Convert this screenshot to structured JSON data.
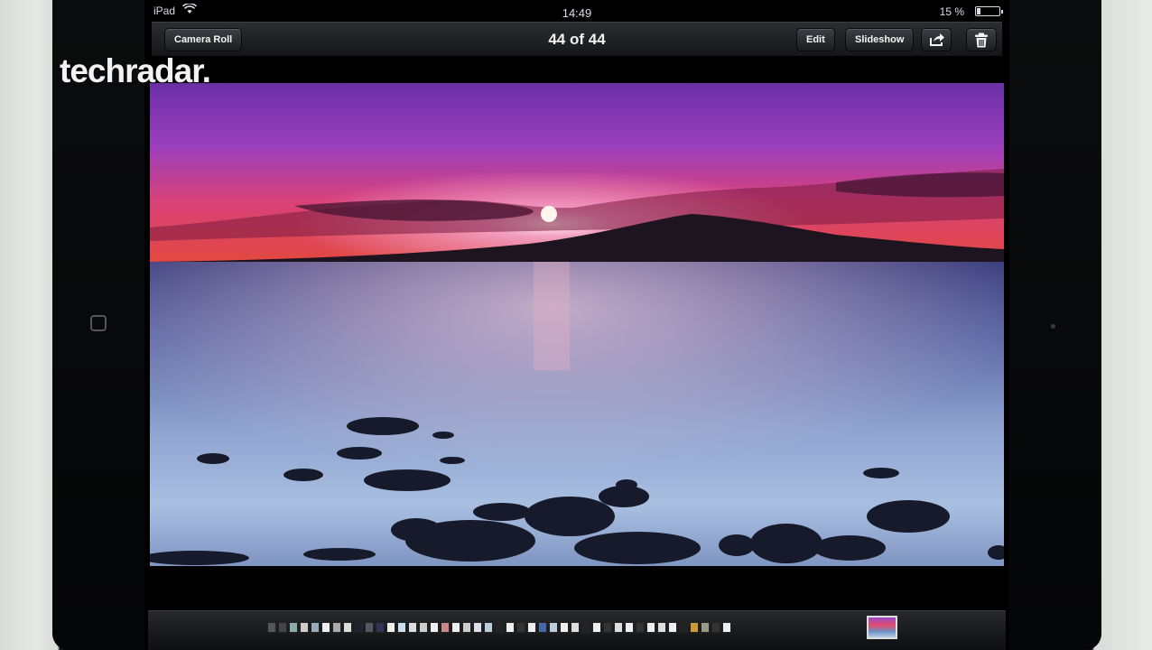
{
  "status_bar": {
    "carrier": "iPad",
    "time": "14:49",
    "battery_text": "15 %",
    "battery_level": 0.15
  },
  "navbar": {
    "back_label": "Camera Roll",
    "title": "44 of 44",
    "edit_label": "Edit",
    "slideshow_label": "Slideshow",
    "share_icon": "share-icon",
    "trash_icon": "trash-icon"
  },
  "photo": {
    "subject": "photo-sunset-seascape"
  },
  "scrubber": {
    "thumbnail_count": 44,
    "selected_index": 44,
    "thumb_colors": [
      "#555",
      "#444",
      "#8aa",
      "#ccc",
      "#9ab",
      "#eee",
      "#aaa",
      "#ddd",
      "#223",
      "#556",
      "#335",
      "#eee",
      "#cde",
      "#ddd",
      "#ccc",
      "#eee",
      "#c88",
      "#eee",
      "#ccc",
      "#dde",
      "#bcd",
      "#222",
      "#eee",
      "#333",
      "#eee",
      "#46a",
      "#bcd",
      "#eee",
      "#ddd",
      "#222",
      "#eee",
      "#333",
      "#ddd",
      "#eee",
      "#333",
      "#eee",
      "#ddd",
      "#eee",
      "#222",
      "#c93",
      "#998",
      "#333",
      "#eee",
      "#336"
    ]
  },
  "watermark": {
    "text": "techradar."
  }
}
